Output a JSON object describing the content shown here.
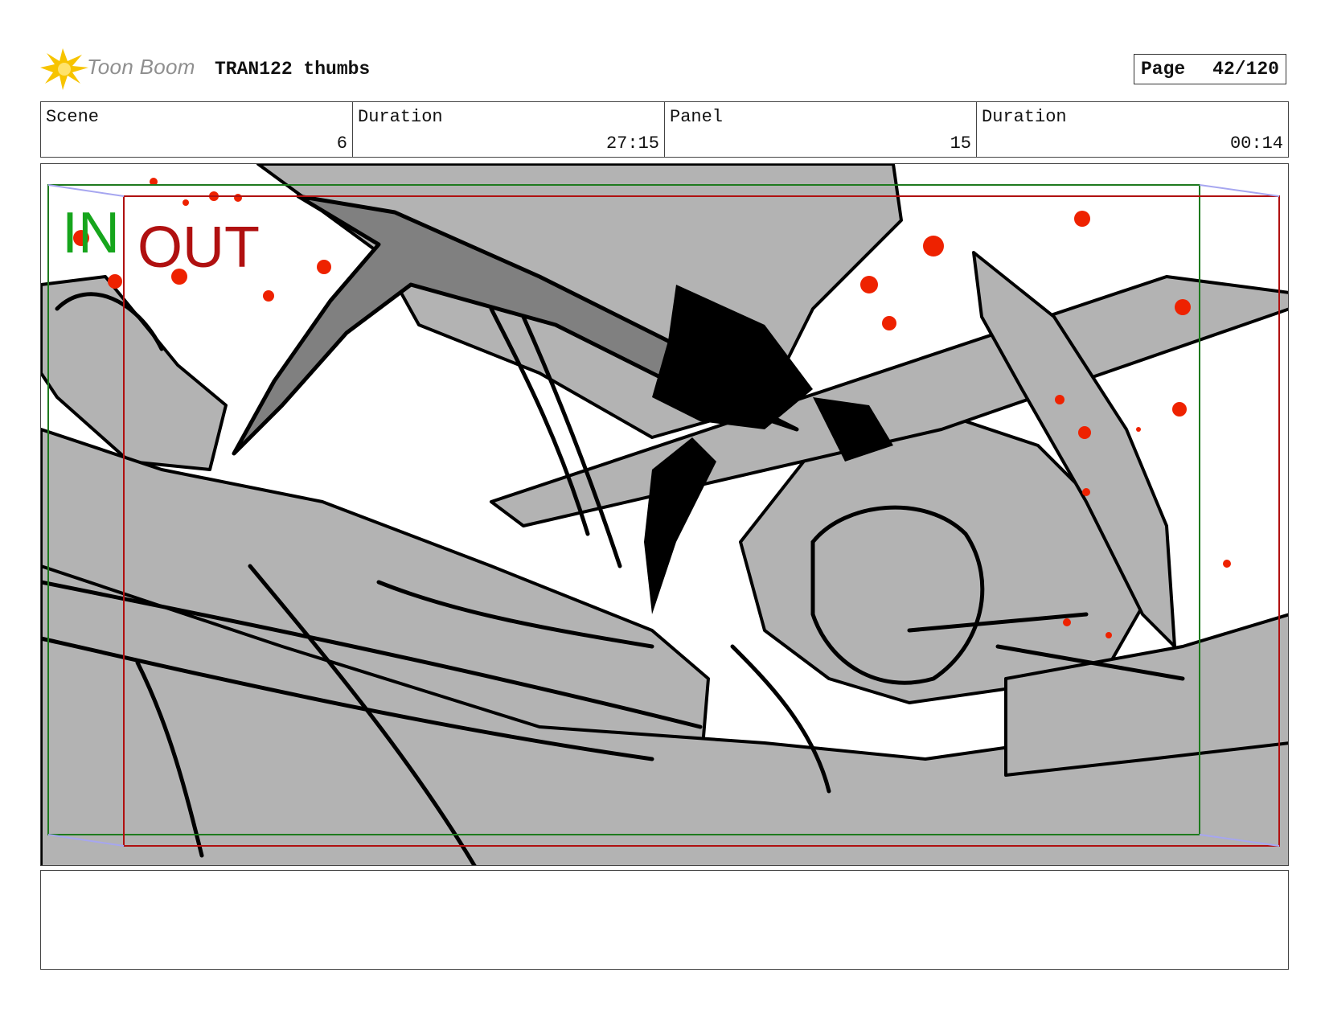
{
  "header": {
    "logo_text": "Toon Boom",
    "doc_title": "TRAN122 thumbs",
    "page_label": "Page",
    "page_value": "42/120"
  },
  "info": {
    "scene_label": "Scene",
    "scene_value": "6",
    "scene_duration_label": "Duration",
    "scene_duration_value": "27:15",
    "panel_label": "Panel",
    "panel_value": "15",
    "panel_duration_label": "Duration",
    "panel_duration_value": "00:14"
  },
  "panel": {
    "in_label": "IN",
    "out_label": "OUT",
    "in_frame_color": "#1e7a1e",
    "out_frame_color": "#b01010",
    "splatter_color": "#ee2200"
  },
  "notes": {
    "text": ""
  }
}
